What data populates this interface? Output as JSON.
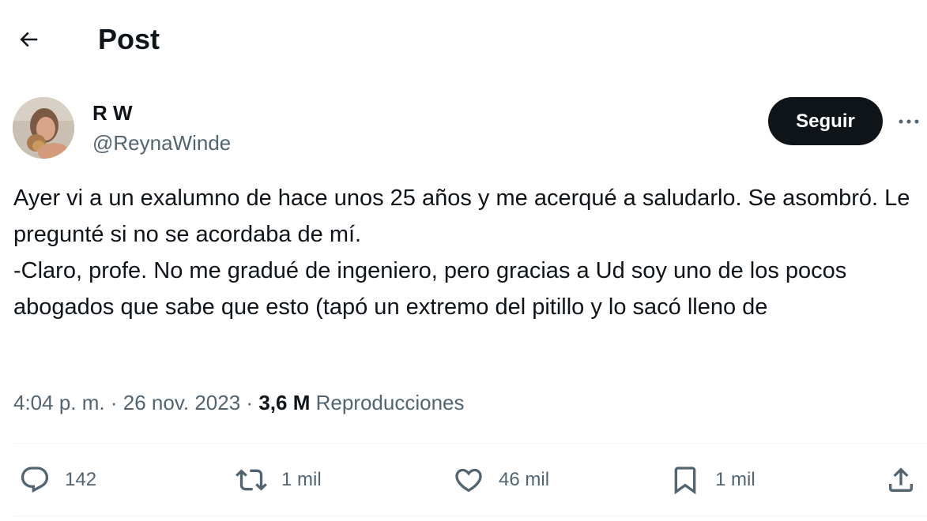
{
  "header": {
    "title": "Post"
  },
  "author": {
    "display_name": "R W",
    "handle": "@ReynaWinde"
  },
  "follow_button": {
    "label": "Seguir"
  },
  "tweet": {
    "text": "Ayer vi a un exalumno de hace unos 25 años y me acerqué a saludarlo. Se asombró. Le pregunté si no se acordaba de mí.\n-Claro, profe. No me gradué de ingeniero, pero gracias a Ud soy uno de los pocos abogados que sabe que esto (tapó un extremo del pitillo y lo sacó lleno de"
  },
  "meta": {
    "time": "4:04 p. m.",
    "separator": "·",
    "date": "26 nov. 2023",
    "views_count": "3,6 M",
    "views_label": "Reproducciones"
  },
  "actions": {
    "replies": "142",
    "reposts": "1 mil",
    "likes": "46 mil",
    "bookmarks": "1 mil"
  },
  "icons": {
    "back": "arrow-left-icon",
    "more": "more-dots-icon",
    "reply": "reply-icon",
    "repost": "repost-icon",
    "like": "heart-icon",
    "bookmark": "bookmark-icon",
    "share": "share-icon"
  },
  "colors": {
    "text": "#0f1419",
    "secondary": "#536471",
    "button_bg": "#0f1419",
    "divider": "#eff3f4"
  }
}
